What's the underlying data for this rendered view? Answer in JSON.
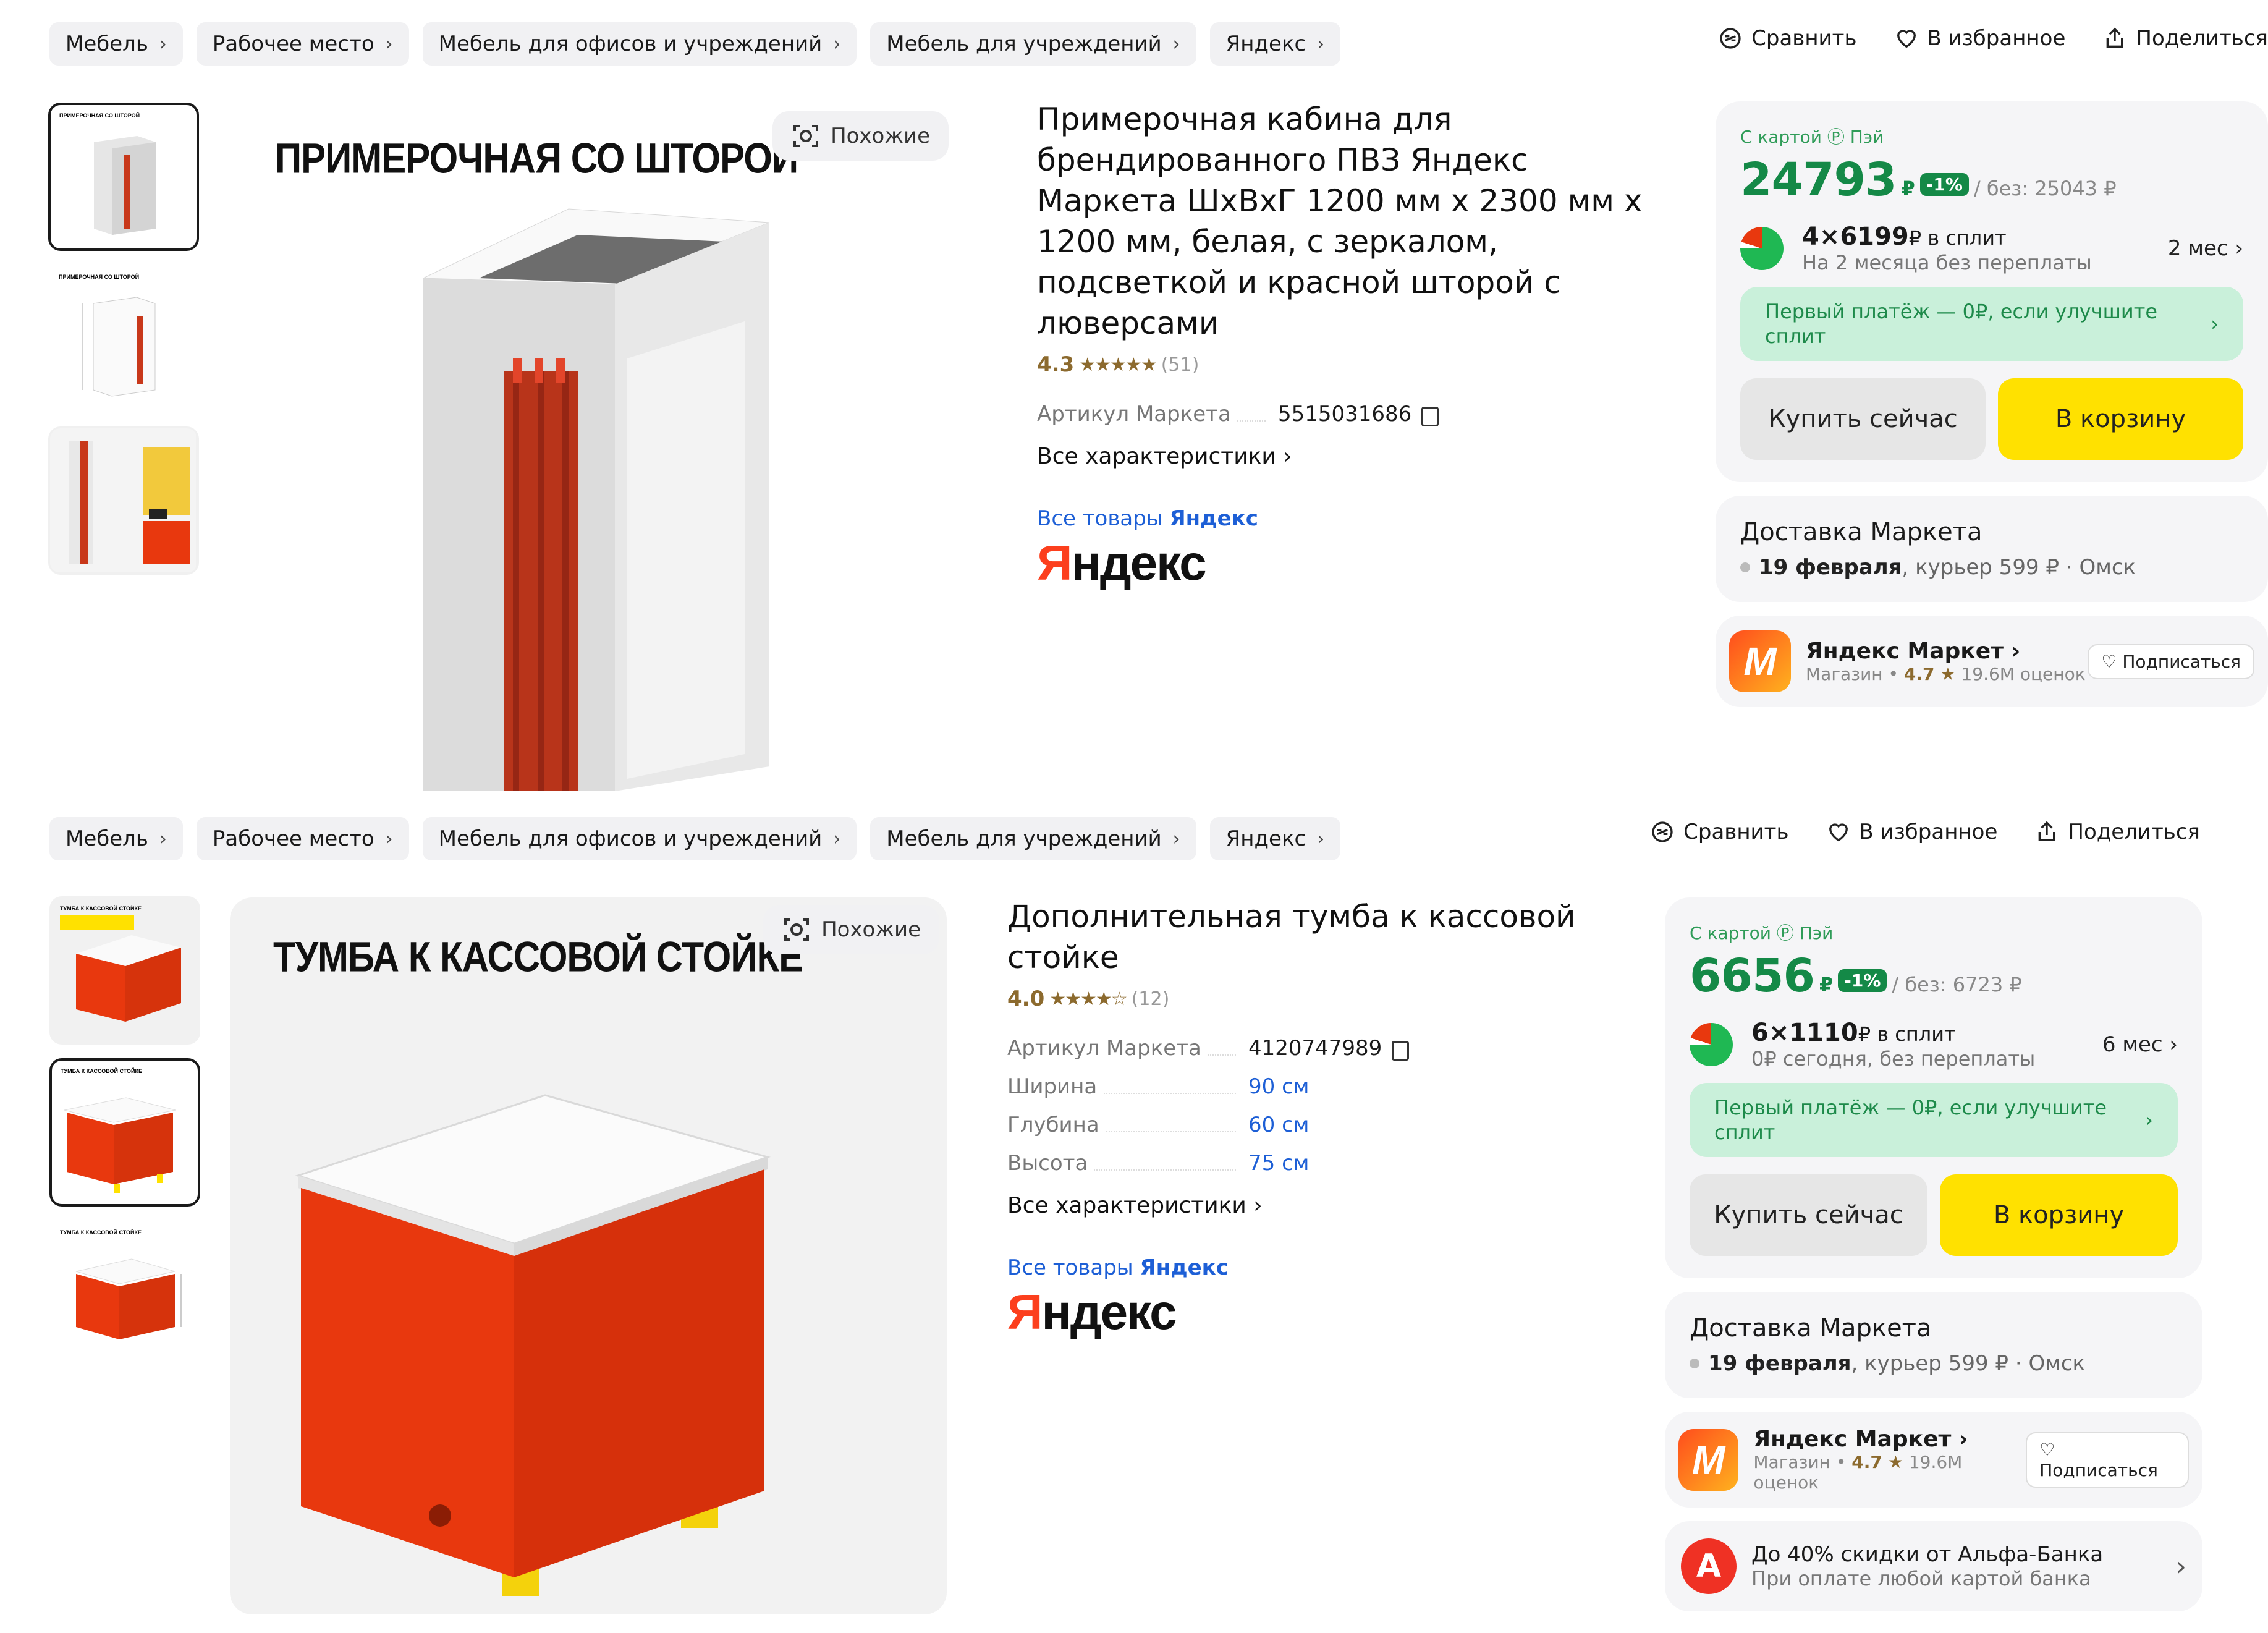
{
  "p1": {
    "crumbs": [
      "Мебель",
      "Рабочее место",
      "Мебель для офисов и учреждений",
      "Мебель для учреждений",
      "Яндекс"
    ],
    "actions": {
      "compare": "Сравнить",
      "fav": "В избранное",
      "share": "Поделиться"
    },
    "image_title": "ПРИМЕРОЧНАЯ СО ШТОРОЙ",
    "similar": "Похожие",
    "title": "Примерочная кабина для брендированного ПВЗ Яндекс Маркета ШхВхГ 1200 мм х 2300 мм х 1200 мм, белая, с зеркалом, подсветкой и красной шторой с люверсами",
    "rating": "4.3",
    "stars": "★★★★★",
    "reviews": "(51)",
    "specs": [
      {
        "k": "Артикул Маркета",
        "v": "5515031686"
      }
    ],
    "all_chars": "Все характеристики",
    "all_goods_prefix": "Все товары",
    "all_goods_brand": "Яндекс",
    "brand_logo": "Яндекс",
    "pay_label": "С картой Ⓟ Пэй",
    "price": "24793",
    "currency": "₽",
    "discount": "-1%",
    "old_price": "/ без: 25043 ₽",
    "split_main": "4×6199",
    "split_unit": "₽ в сплит",
    "split_sub": "На 2 месяца без переплаты",
    "split_months": "2 мес",
    "first_pay": "Первый платёж — 0₽, если улучшите сплит",
    "buy_now": "Купить сейчас",
    "to_cart": "В корзину",
    "delivery_title": "Доставка Маркета",
    "delivery_date": "19 февраля",
    "delivery_rest": ", курьер 599 ₽ · Омск",
    "shop_name": "Яндекс Маркет",
    "shop_type": "Магазин",
    "shop_rating": "4.7",
    "shop_reviews": "19.6M оценок",
    "subscribe": "Подписаться"
  },
  "p2": {
    "crumbs": [
      "Мебель",
      "Рабочее место",
      "Мебель для офисов и учреждений",
      "Мебель для учреждений",
      "Яндекс"
    ],
    "actions": {
      "compare": "Сравнить",
      "fav": "В избранное",
      "share": "Поделиться"
    },
    "image_title": "ТУМБА К КАССОВОЙ СТОЙКЕ",
    "similar": "Похожие",
    "title": "Дополнительная тумба к кассовой стойке",
    "rating": "4.0",
    "stars": "★★★★☆",
    "reviews": "(12)",
    "specs": [
      {
        "k": "Артикул Маркета",
        "v": "4120747989"
      },
      {
        "k": "Ширина",
        "v": "90 см"
      },
      {
        "k": "Глубина",
        "v": "60 см"
      },
      {
        "k": "Высота",
        "v": "75 см"
      }
    ],
    "all_chars": "Все характеристики",
    "all_goods_prefix": "Все товары",
    "all_goods_brand": "Яндекс",
    "brand_logo": "Яндекс",
    "pay_label": "С картой Ⓟ Пэй",
    "price": "6656",
    "currency": "₽",
    "discount": "-1%",
    "old_price": "/ без: 6723 ₽",
    "split_main": "6×1110",
    "split_unit": "₽ в сплит",
    "split_sub": "0₽ сегодня, без переплаты",
    "split_months": "6 мес",
    "first_pay": "Первый платёж — 0₽, если улучшите сплит",
    "buy_now": "Купить сейчас",
    "to_cart": "В корзину",
    "delivery_title": "Доставка Маркета",
    "delivery_date": "19 февраля",
    "delivery_rest": ", курьер 599 ₽ · Омск",
    "shop_name": "Яндекс Маркет",
    "shop_type": "Магазин",
    "shop_rating": "4.7",
    "shop_reviews": "19.6M оценок",
    "subscribe": "Подписаться",
    "alfa_title": "До 40% скидки от Альфа-Банка",
    "alfa_sub": "При оплате любой картой банка",
    "alfa_logo": "А"
  },
  "colors": {
    "price_green": "#148947",
    "cart_yellow": "#ffe100",
    "yandex_red": "#fc3f1d",
    "link_blue": "#1d5fd6"
  },
  "icons": [
    "compare-icon",
    "heart-icon",
    "share-icon",
    "similar-icon",
    "copy-icon",
    "chevron-right-icon"
  ]
}
